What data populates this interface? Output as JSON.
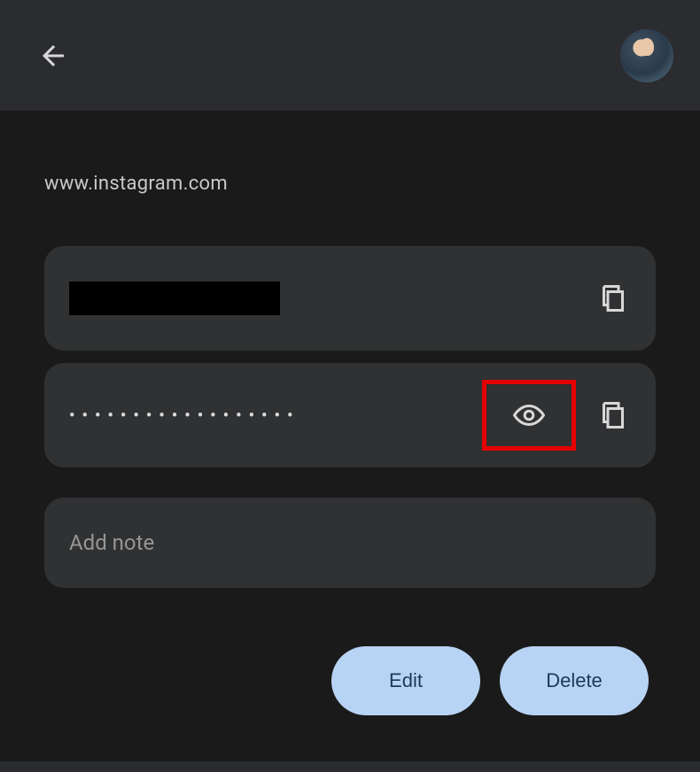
{
  "site": "www.instagram.com",
  "username": {
    "value_redacted": true
  },
  "password": {
    "masked": "••••••••••••••••••"
  },
  "note": {
    "placeholder": "Add note"
  },
  "buttons": {
    "edit": "Edit",
    "delete": "Delete"
  }
}
